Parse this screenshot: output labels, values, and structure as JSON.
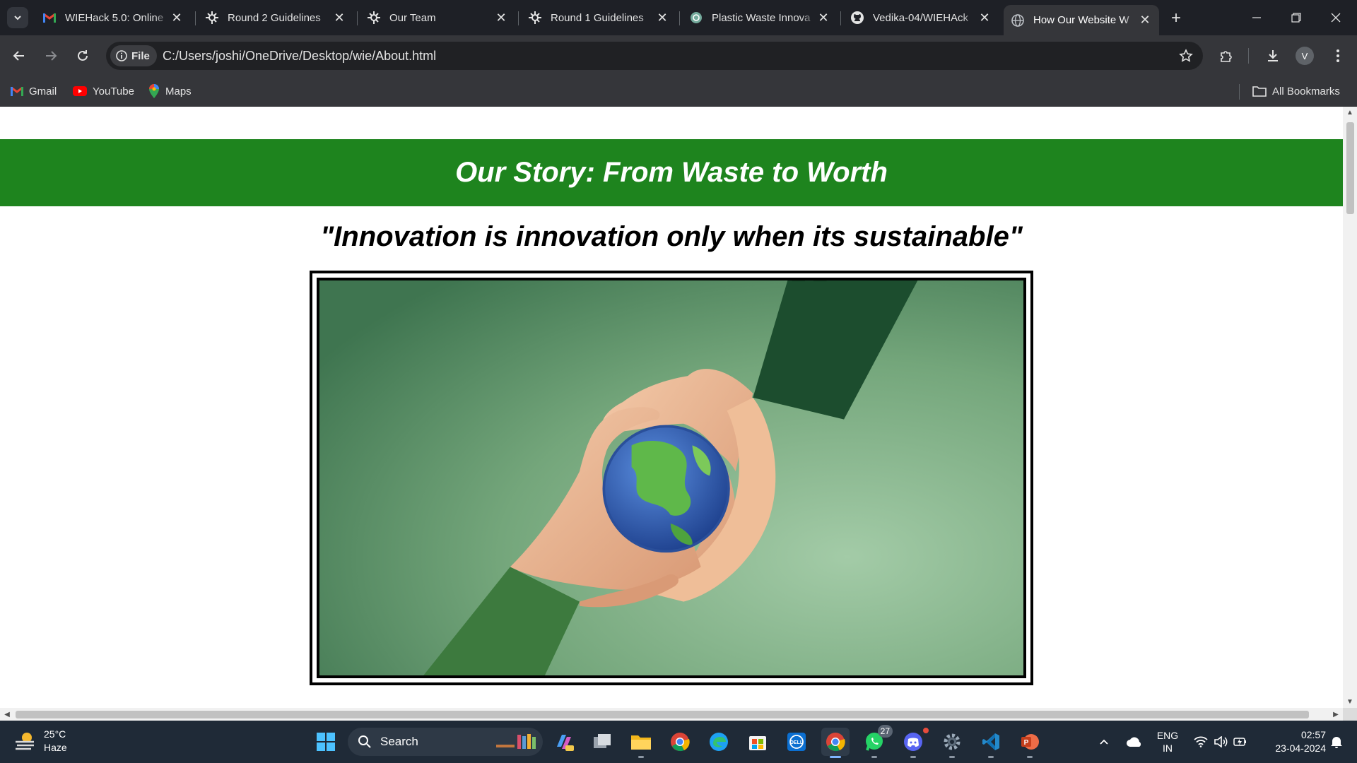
{
  "tabs": [
    {
      "title": "WIEHack 5.0: Online",
      "icon": "gmail-icon"
    },
    {
      "title": "Round 2 Guidelines",
      "icon": "unstop-icon"
    },
    {
      "title": "Our Team",
      "icon": "unstop-icon"
    },
    {
      "title": "Round 1 Guidelines",
      "icon": "unstop-icon"
    },
    {
      "title": "Plastic Waste Innova",
      "icon": "chatgpt-icon"
    },
    {
      "title": "Vedika-04/WIEHAck",
      "icon": "github-icon"
    },
    {
      "title": "How Our Website W",
      "icon": "globe-icon",
      "active": true
    }
  ],
  "omnibox": {
    "chip_label": "File",
    "url": "C:/Users/joshi/OneDrive/Desktop/wie/About.html"
  },
  "profile_initial": "V",
  "bookmarks": [
    {
      "label": "Gmail",
      "icon": "gmail-icon"
    },
    {
      "label": "YouTube",
      "icon": "youtube-icon"
    },
    {
      "label": "Maps",
      "icon": "maps-icon"
    }
  ],
  "all_bookmarks_label": "All Bookmarks",
  "page": {
    "hero_title": "Our Story: From Waste to Worth",
    "quote": "\"Innovation is innovation only when its sustainable\"",
    "colors": {
      "banner": "#1e841e",
      "sweater": "#1c4d2e",
      "background": "#6f9e76"
    }
  },
  "taskbar": {
    "weather_temp": "25°C",
    "weather_desc": "Haze",
    "search_label": "Search",
    "whatsapp_badge": "27",
    "lang_line1": "ENG",
    "lang_line2": "IN",
    "time": "02:57",
    "date": "23-04-2024"
  }
}
